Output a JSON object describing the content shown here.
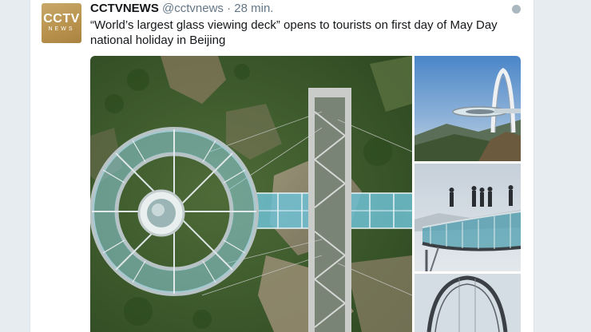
{
  "tweet": {
    "author_name": "CCTVNEWS",
    "handle": "@cctvnews",
    "separator": "·",
    "time": "28 min.",
    "text": "“World’s largest glass viewing deck” opens to tourists on first day of May Day national holiday in Beijing"
  },
  "avatar": {
    "logo_line1": "CCTV",
    "logo_line2": "NEWS"
  },
  "icons": {
    "globe": "globe-icon"
  },
  "media": {
    "photos": [
      {
        "id": "main",
        "desc": "aerial view of circular glass deck"
      },
      {
        "id": "thumb1",
        "desc": "deck with arch against sky"
      },
      {
        "id": "thumb2",
        "desc": "tourists on glass platform"
      },
      {
        "id": "thumb3",
        "desc": "steel arch"
      }
    ]
  },
  "colors": {
    "page_bg": "#e6ecf0",
    "text": "#14171a",
    "muted": "#657786",
    "avatar_gold": "#b8924c"
  }
}
